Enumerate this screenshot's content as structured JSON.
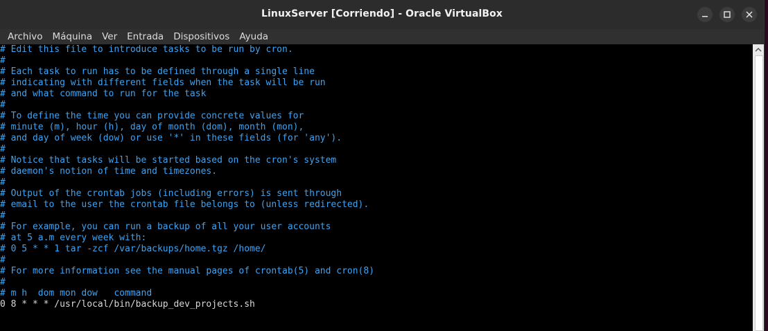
{
  "window": {
    "title": "LinuxServer [Corriendo] - Oracle VirtualBox"
  },
  "menubar": {
    "items": [
      "Archivo",
      "Máquina",
      "Ver",
      "Entrada",
      "Dispositivos",
      "Ayuda"
    ]
  },
  "controls": {
    "minimize_icon": "minimize-icon",
    "maximize_icon": "maximize-icon",
    "close_icon": "close-icon"
  },
  "colors": {
    "comment": "#3fa3f0",
    "code": "#d8d8d8",
    "titlebar": "#2c2c2c"
  },
  "terminal": {
    "lines": [
      {
        "type": "comment",
        "text": "# Edit this file to introduce tasks to be run by cron."
      },
      {
        "type": "comment",
        "text": "#"
      },
      {
        "type": "comment",
        "text": "# Each task to run has to be defined through a single line"
      },
      {
        "type": "comment",
        "text": "# indicating with different fields when the task will be run"
      },
      {
        "type": "comment",
        "text": "# and what command to run for the task"
      },
      {
        "type": "comment",
        "text": "#"
      },
      {
        "type": "comment",
        "text": "# To define the time you can provide concrete values for"
      },
      {
        "type": "comment",
        "text": "# minute (m), hour (h), day of month (dom), month (mon),"
      },
      {
        "type": "comment",
        "text": "# and day of week (dow) or use '*' in these fields (for 'any')."
      },
      {
        "type": "comment",
        "text": "#"
      },
      {
        "type": "comment",
        "text": "# Notice that tasks will be started based on the cron's system"
      },
      {
        "type": "comment",
        "text": "# daemon's notion of time and timezones."
      },
      {
        "type": "comment",
        "text": "#"
      },
      {
        "type": "comment",
        "text": "# Output of the crontab jobs (including errors) is sent through"
      },
      {
        "type": "comment",
        "text": "# email to the user the crontab file belongs to (unless redirected)."
      },
      {
        "type": "comment",
        "text": "#"
      },
      {
        "type": "comment",
        "text": "# For example, you can run a backup of all your user accounts"
      },
      {
        "type": "comment",
        "text": "# at 5 a.m every week with:"
      },
      {
        "type": "comment",
        "text": "# 0 5 * * 1 tar -zcf /var/backups/home.tgz /home/"
      },
      {
        "type": "comment",
        "text": "#"
      },
      {
        "type": "comment",
        "text": "# For more information see the manual pages of crontab(5) and cron(8)"
      },
      {
        "type": "comment",
        "text": "#"
      },
      {
        "type": "comment",
        "text": "# m h  dom mon dow   command"
      },
      {
        "type": "code",
        "text": "0 8 * * * /usr/local/bin/backup_dev_projects.sh"
      }
    ]
  }
}
